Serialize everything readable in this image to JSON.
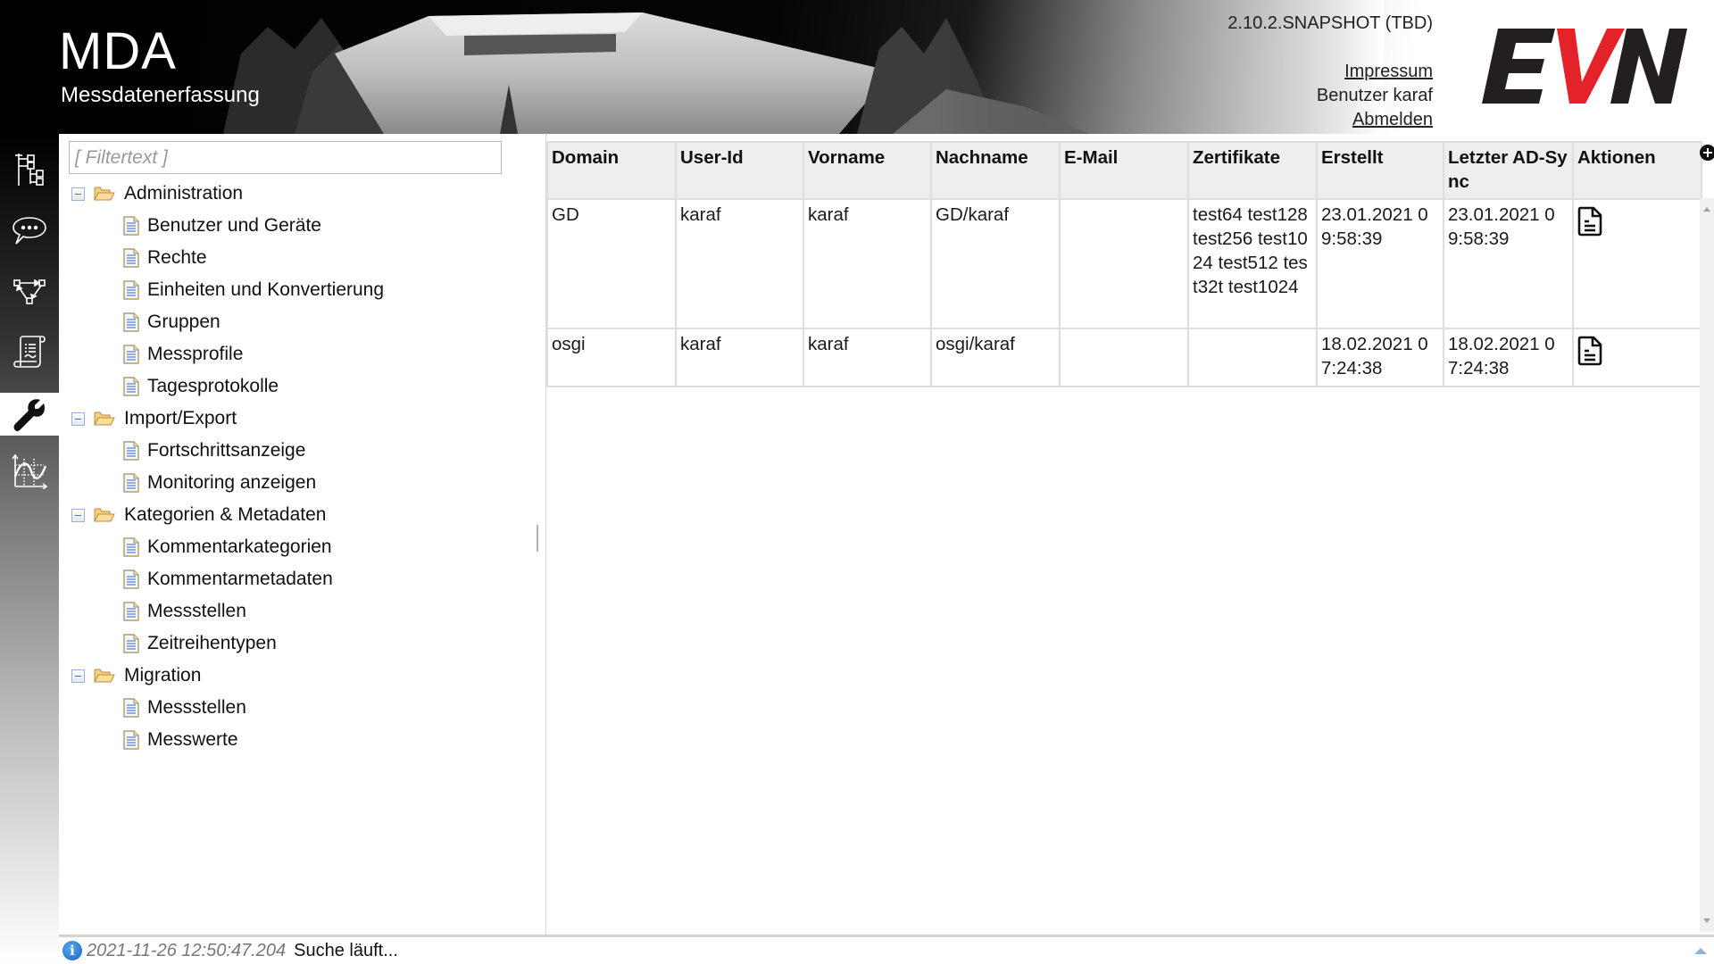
{
  "header": {
    "title": "MDA",
    "subtitle": "Messdatenerfassung",
    "version": "2.10.2.SNAPSHOT (TBD)",
    "impressum_label": "Impressum",
    "user_label": "Benutzer karaf",
    "logout_label": "Abmelden",
    "logo_text": "EVN",
    "logo_colors": {
      "dark": "#231f20",
      "accent": "#e3222a"
    }
  },
  "sidebar": {
    "items": [
      {
        "name": "hierarchy",
        "icon": "hierarchy-icon",
        "active": false
      },
      {
        "name": "comments",
        "icon": "speech-bubble-icon",
        "active": false
      },
      {
        "name": "workflow",
        "icon": "workflow-graph-icon",
        "active": false
      },
      {
        "name": "protocol",
        "icon": "scroll-document-icon",
        "active": false
      },
      {
        "name": "administration",
        "icon": "wrench-icon",
        "active": true
      },
      {
        "name": "charts",
        "icon": "line-chart-icon",
        "active": false
      }
    ]
  },
  "tree": {
    "filter_placeholder": "[ Filtertext ]",
    "groups": [
      {
        "label": "Administration",
        "expanded": true,
        "children": [
          "Benutzer und Geräte",
          "Rechte",
          "Einheiten und Konvertierung",
          "Gruppen",
          "Messprofile",
          "Tagesprotokolle"
        ]
      },
      {
        "label": "Import/Export",
        "expanded": true,
        "children": [
          "Fortschrittsanzeige",
          "Monitoring anzeigen"
        ]
      },
      {
        "label": "Kategorien & Metadaten",
        "expanded": true,
        "children": [
          "Kommentarkategorien",
          "Kommentarmetadaten",
          "Messstellen",
          "Zeitreihentypen"
        ]
      },
      {
        "label": "Migration",
        "expanded": true,
        "children": [
          "Messstellen",
          "Messwerte"
        ]
      }
    ]
  },
  "table": {
    "columns": [
      "Domain",
      "User-Id",
      "Vorname",
      "Nachname",
      "E-Mail",
      "Zertifikate",
      "Erstellt",
      "Letzter AD-Sync",
      "Aktionen"
    ],
    "rows": [
      {
        "domain": "GD",
        "user_id": "karaf",
        "vorname": "karaf",
        "nachname": "GD/karaf",
        "email": "",
        "zertifikate": "test64 test128 test256 test1024 test512 test32t test1024",
        "erstellt": "23.01.2021 09:58:39",
        "ad_sync": "23.01.2021 09:58:39",
        "action_icon": "document-icon"
      },
      {
        "domain": "osgi",
        "user_id": "karaf",
        "vorname": "karaf",
        "nachname": "osgi/karaf",
        "email": "",
        "zertifikate": "",
        "erstellt": "18.02.2021 07:24:38",
        "ad_sync": "18.02.2021 07:24:38",
        "action_icon": "document-icon"
      }
    ],
    "add_button_icon": "plus-circle-icon"
  },
  "status": {
    "icon": "info-icon",
    "icon_glyph": "i",
    "timestamp": "2021-11-26 12:50:47.204",
    "message": "Suche läuft..."
  }
}
